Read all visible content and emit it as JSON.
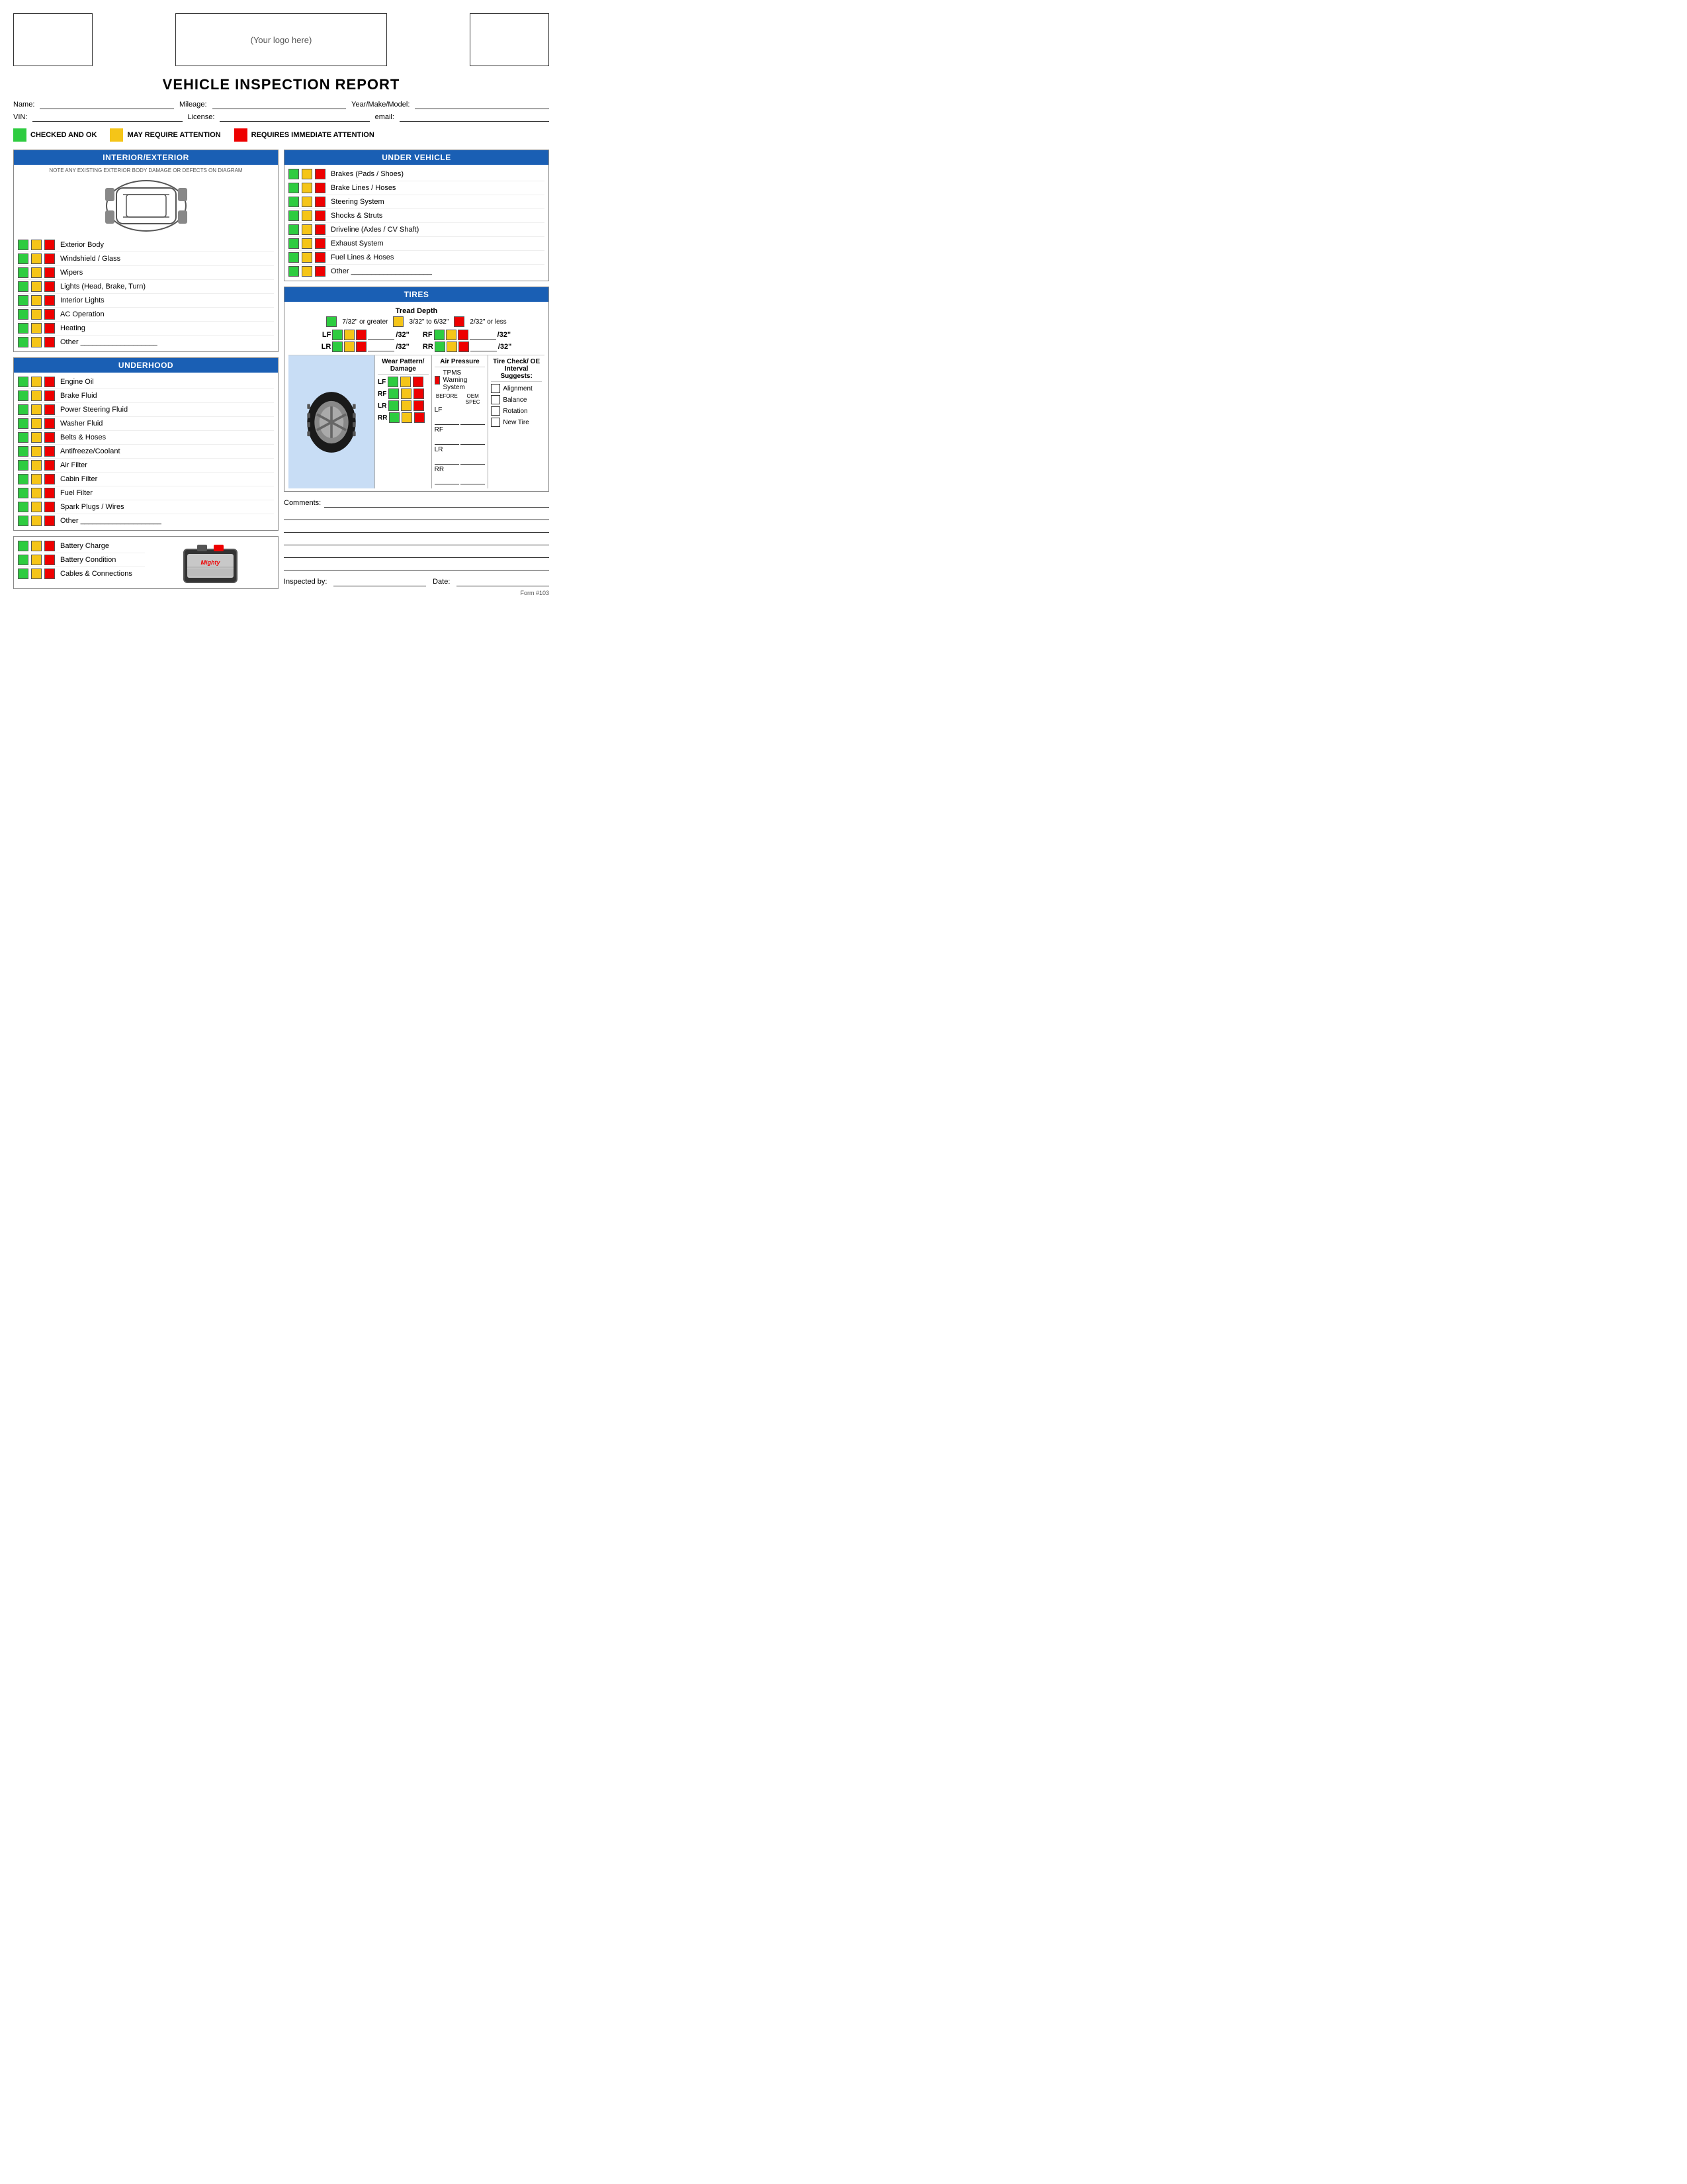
{
  "header": {
    "logo_text": "(Your logo here)"
  },
  "title": "VEHICLE INSPECTION REPORT",
  "form": {
    "name_label": "Name:",
    "mileage_label": "Mileage:",
    "year_make_model_label": "Year/Make/Model:",
    "vin_label": "VIN:",
    "license_label": "License:",
    "email_label": "email:"
  },
  "legend": {
    "green_label": "CHECKED AND OK",
    "yellow_label": "MAY REQUIRE ATTENTION",
    "red_label": "REQUIRES IMMEDIATE ATTENTION"
  },
  "interior_exterior": {
    "header": "INTERIOR/EXTERIOR",
    "note": "NOTE ANY EXISTING EXTERIOR BODY DAMAGE OR DEFECTS ON DIAGRAM",
    "items": [
      "Exterior Body",
      "Windshield / Glass",
      "Wipers",
      "Lights (Head, Brake, Turn)",
      "Interior Lights",
      "AC Operation",
      "Heating",
      "Other ___________________"
    ]
  },
  "under_vehicle": {
    "header": "UNDER VEHICLE",
    "items": [
      "Brakes (Pads / Shoes)",
      "Brake Lines / Hoses",
      "Steering System",
      "Shocks & Struts",
      "Driveline (Axles / CV Shaft)",
      "Exhaust System",
      "Fuel Lines & Hoses",
      "Other ____________________"
    ]
  },
  "underhood": {
    "header": "UNDERHOOD",
    "items": [
      "Engine Oil",
      "Brake Fluid",
      "Power Steering Fluid",
      "Washer Fluid",
      "Belts & Hoses",
      "Antifreeze/Coolant",
      "Air Filter",
      "Cabin Filter",
      "Fuel Filter",
      "Spark Plugs / Wires",
      "Other ____________________"
    ]
  },
  "battery": {
    "items": [
      "Battery Charge",
      "Battery Condition",
      "Cables & Connections"
    ]
  },
  "tires": {
    "header": "TIRES",
    "tread_depth_label": "Tread Depth",
    "green_label": "7/32\" or greater",
    "yellow_label": "3/32\" to 6/32\"",
    "red_label": "2/32\" or less",
    "positions": [
      "LF",
      "RF",
      "LR",
      "RR"
    ],
    "wear_pattern_label": "Wear Pattern/ Damage",
    "air_pressure_label": "Air Pressure",
    "tpms_label": "TPMS Warning System",
    "before_label": "BEFORE",
    "oemspec_label": "OEM SPEC",
    "tire_check_label": "Tire Check/ OE Interval Suggests:",
    "checkboxes": [
      "Alignment",
      "Balance",
      "Rotation",
      "New Tire"
    ]
  },
  "comments": {
    "label": "Comments:"
  },
  "inspected_by": {
    "label": "Inspected by:",
    "date_label": "Date:"
  },
  "form_number": "Form #103"
}
